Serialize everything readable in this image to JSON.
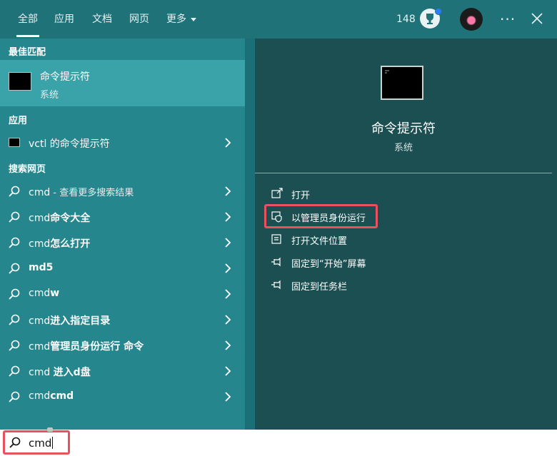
{
  "header": {
    "tabs": [
      {
        "label": "全部",
        "active": true
      },
      {
        "label": "应用"
      },
      {
        "label": "文档"
      },
      {
        "label": "网页"
      },
      {
        "label": "更多"
      }
    ],
    "points": "148",
    "more_glyph": "···"
  },
  "left": {
    "best_match_heading": "最佳匹配",
    "best_match": {
      "title": "命令提示符",
      "subtitle": "系统"
    },
    "apps_heading": "应用",
    "apps": [
      {
        "label": "vctl 的命令提示符"
      }
    ],
    "web_heading": "搜索网页",
    "web_results": [
      {
        "plain": "cmd",
        "bold": "",
        "suffix": " - 查看更多搜索结果"
      },
      {
        "plain": "cmd",
        "bold": "命令大全",
        "suffix": ""
      },
      {
        "plain": "cmd",
        "bold": "怎么打开",
        "suffix": ""
      },
      {
        "plain": "",
        "bold": "md5",
        "suffix": ""
      },
      {
        "plain": "cmd",
        "bold": "w",
        "suffix": ""
      },
      {
        "plain": "cmd",
        "bold": "进入指定目录",
        "suffix": ""
      },
      {
        "plain": "cmd",
        "bold": "管理员身份运行 命令",
        "suffix": ""
      },
      {
        "plain": "cmd ",
        "bold": "进入d盘",
        "suffix": ""
      },
      {
        "plain": "cmd",
        "bold": "cmd",
        "suffix": ""
      }
    ]
  },
  "right": {
    "title": "命令提示符",
    "subtitle": "系统",
    "actions": [
      {
        "label": "打开",
        "icon": "open-icon"
      },
      {
        "label": "以管理员身份运行",
        "icon": "shield-icon",
        "highlighted": true
      },
      {
        "label": "打开文件位置",
        "icon": "folder-icon"
      },
      {
        "label": "固定到“开始”屏幕",
        "icon": "pin-icon"
      },
      {
        "label": "固定到任务栏",
        "icon": "pin-icon"
      }
    ]
  },
  "search": {
    "value": "cmd"
  },
  "colors": {
    "highlight": "#e8515f",
    "accent": "#2a7dff"
  }
}
